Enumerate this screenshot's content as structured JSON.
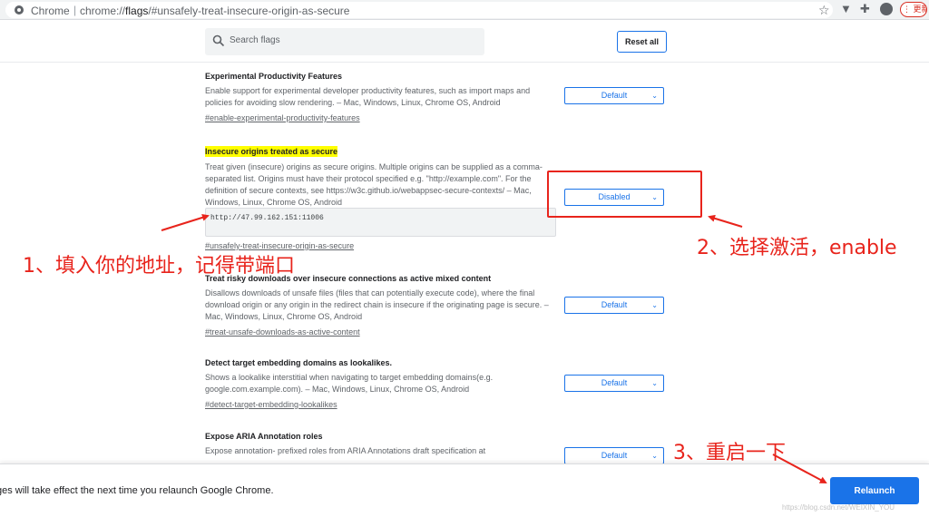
{
  "browser": {
    "scheme_label": "Chrome",
    "separator": "|",
    "url_prefix": "chrome://",
    "url_host": "flags",
    "url_suffix": "/#unsafely-treat-insecure-origin-as-secure",
    "update_label": "更新"
  },
  "search": {
    "placeholder": "Search flags",
    "reset_label": "Reset all"
  },
  "experiments": [
    {
      "title": "Experimental Productivity Features",
      "description": "Enable support for experimental developer productivity features, such as import maps and policies for avoiding slow rendering. – Mac, Windows, Linux, Chrome OS, Android",
      "link": "#enable-experimental-productivity-features",
      "value": "Default"
    },
    {
      "title": "Insecure origins treated as secure",
      "description": "Treat given (insecure) origins as secure origins. Multiple origins can be supplied as a comma-separated list. Origins must have their protocol specified e.g. \"http://example.com\". For the definition of secure contexts, see https://w3c.github.io/webappsec-secure-contexts/ – Mac, Windows, Linux, Chrome OS, Android",
      "input_value": "http://47.99.162.151:11006",
      "link": "#unsafely-treat-insecure-origin-as-secure",
      "value": "Disabled"
    },
    {
      "title": "Treat risky downloads over insecure connections as active mixed content",
      "description": "Disallows downloads of unsafe files (files that can potentially execute code), where the final download origin or any origin in the redirect chain is insecure if the originating page is secure. – Mac, Windows, Linux, Chrome OS, Android",
      "link": "#treat-unsafe-downloads-as-active-content",
      "value": "Default"
    },
    {
      "title": "Detect target embedding domains as lookalikes.",
      "description": "Shows a lookalike interstitial when navigating to target embedding domains(e.g. google.com.example.com). – Mac, Windows, Linux, Chrome OS, Android",
      "link": "#detect-target-embedding-lookalikes",
      "value": "Default"
    },
    {
      "title": "Expose ARIA Annotation roles",
      "description": "Expose annotation- prefixed roles from ARIA Annotations draft specification at",
      "value": "Default"
    }
  ],
  "relaunch": {
    "message": "ges will take effect the next time you relaunch Google Chrome.",
    "button_label": "Relaunch",
    "watermark": "https://blog.csdn.net/WEIXIN_YOU"
  },
  "annotations": {
    "step1": "1、填入你的地址，记得带端口",
    "step2": "2、选择激活，enable",
    "step3": "3、重启一下",
    "color": "#e8241c"
  }
}
